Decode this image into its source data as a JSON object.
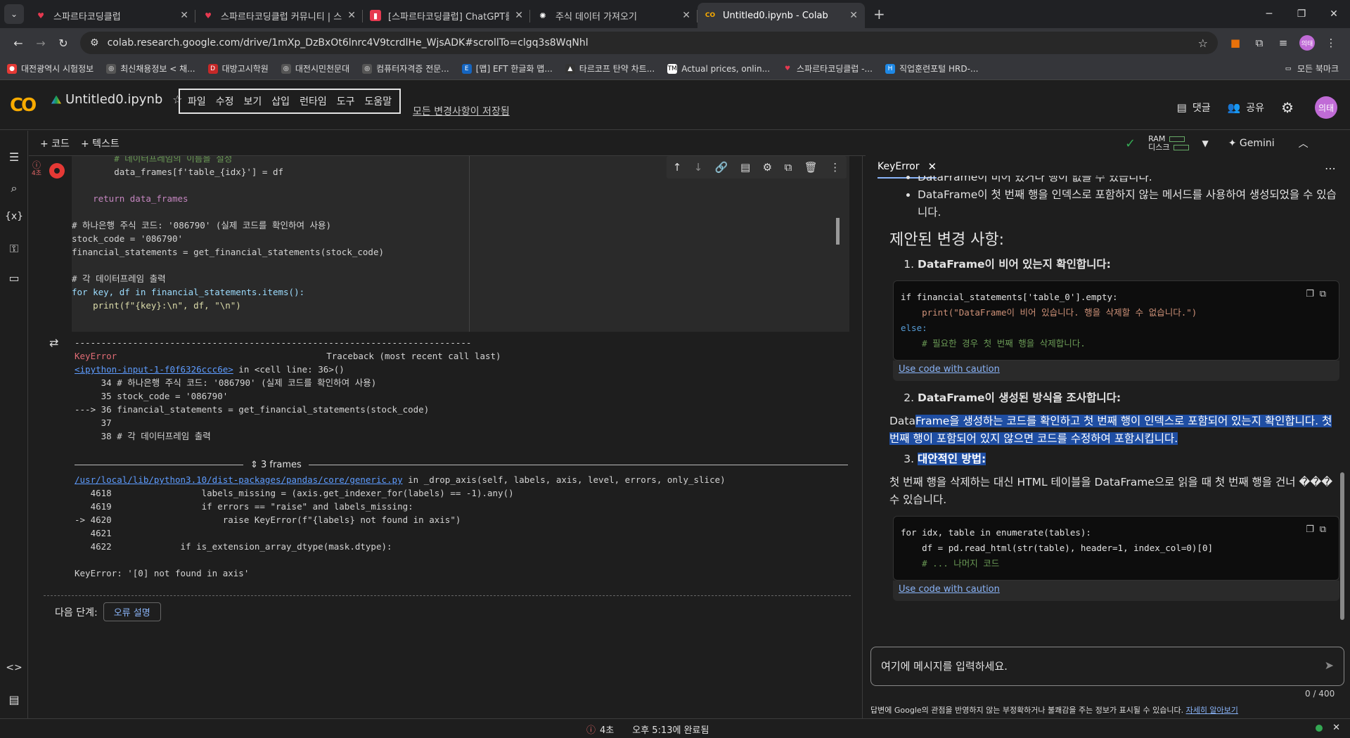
{
  "browser": {
    "tabs": [
      {
        "title": "스파르타코딩클럽",
        "icon": "heart-icon",
        "color": "#e63950"
      },
      {
        "title": "스파르타코딩클럽 커뮤니티 | 스",
        "icon": "heart-icon",
        "color": "#e63950"
      },
      {
        "title": "[스파르타코딩클럽] ChatGPT를",
        "icon": "bookmark-icon",
        "color": "#e63950"
      },
      {
        "title": "주식 데이터 가져오기",
        "icon": "openai-icon",
        "color": "#ffffff"
      },
      {
        "title": "Untitled0.ipynb - Colab",
        "icon": "colab-icon",
        "color": "#f9ab00",
        "active": true
      }
    ],
    "url": "colab.research.google.com/drive/1mXp_DzBxOt6lnrc4V9tcrdlHe_WjsADK#scrollTo=clgq3s8WqNhl",
    "bookmarks": [
      "대전광역시 시험정보",
      "최신채용정보 < 채...",
      "대방고시학원",
      "대전시민천문대",
      "컴퓨터자격증 전문...",
      "[맵] EFT 한글화 맵...",
      "타르코프 탄약 차트...",
      "Actual prices, onlin...",
      "스파르타코딩클럽 -...",
      "직업훈련포털 HRD-..."
    ],
    "bookmarks_all": "모든 북마크",
    "profile_initials": "의태"
  },
  "colab": {
    "logo": "CO",
    "title": "Untitled0.ipynb",
    "menus": [
      "파일",
      "수정",
      "보기",
      "삽입",
      "런타임",
      "도구",
      "도움말"
    ],
    "saved": "모든 변경사항이 저장됨",
    "comment": "댓글",
    "share": "공유",
    "avatar": "의태",
    "add_code": "+ 코드",
    "add_text": "+ 텍스트",
    "ram": "RAM",
    "disk": "디스크",
    "gemini": "Gemini",
    "exec_time": "4초"
  },
  "code_lines": [
    "        # 데이터프레임의 이름을 설정",
    "        data_frames[f'table_{idx}'] = df",
    "",
    "    return data_frames",
    "",
    "# 하나은행 주식 코드: '086790' (실제 코드를 확인하여 사용)",
    "stock_code = '086790'",
    "financial_statements = get_financial_statements(stock_code)",
    "",
    "# 각 데이터프레임 출력",
    "for key, df in financial_statements.items():",
    "    print(f\"{key}:\\n\", df, \"\\n\")"
  ],
  "traceback": {
    "divider": "---------------------------------------------------------------------------",
    "error_name": "KeyError",
    "tb_header": "Traceback (most recent call last)",
    "input_link": "<ipython-input-1-f0f6326ccc6e>",
    "input_loc": " in <cell line: 36>()",
    "l34": "     34 # 하나은행 주식 코드: '086790' (실제 코드를 확인하여 사용)",
    "l35": "     35 stock_code = '086790'",
    "l36": "---> 36 financial_statements = get_financial_statements(stock_code)",
    "l37": "     37",
    "l38": "     38 # 각 데이터프레임 출력",
    "frames": "3 frames",
    "file_link": "/usr/local/lib/python3.10/dist-packages/pandas/core/generic.py",
    "file_loc": " in _drop_axis(self, labels, axis, level, errors, only_slice)",
    "f4618": "   4618                 labels_missing = (axis.get_indexer_for(labels) == -1).any()",
    "f4619": "   4619                 if errors == \"raise\" and labels_missing:",
    "f4620": "-> 4620                     raise KeyError(f\"{labels} not found in axis\")",
    "f4621": "   4621",
    "f4622": "   4622             if is_extension_array_dtype(mask.dtype):",
    "final": "KeyError: '[0] not found in axis'"
  },
  "next_step": {
    "label": "다음 단계:",
    "button": "오류 설명"
  },
  "panel": {
    "tab": "KeyError",
    "bullet1": "DataFrame이 비어 있거나 행이 없을 수 있습니다.",
    "bullet2": "DataFrame이 첫 번째 행을 인덱스로 포함하지 않는 메서드를 사용하여 생성되었을 수 있습니다.",
    "heading": "제안된 변경 사항:",
    "step1": "DataFrame이 비어 있는지 확인합니다:",
    "code1": [
      "if financial_statements['table_0'].empty:",
      "    print(\"DataFrame이 비어 있습니다. 행을 삭제할 수 없습니다.\")",
      "else:",
      "    # 필요한 경우 첫 번째 행을 삭제합니다."
    ],
    "caution": "Use code with caution",
    "step2": "DataFrame이 생성된 방식을 조사합니다:",
    "para2a": "Data",
    "para2b": "Frame을 생성하는 코드를 확인하고 첫 번째 행이 인덱스로 포함되어 있는지 확인합니다. 첫 번째 행이 포함되어 있지 않으면 코드를 수정하여 포함시킵니다.",
    "step3": "대안적인 방법:",
    "para3": "첫 번째 행을 삭제하는 대신 HTML 테이블을 DataFrame으로 읽을 때 첫 번째 행을 건너 ��� 수 있습니다.",
    "code2": [
      "for idx, table in enumerate(tables):",
      "    df = pd.read_html(str(table), header=1, index_col=0)[0]",
      "    # ... 나머지 코드"
    ],
    "input_placeholder": "여기에 메시지를 입력하세요.",
    "counter": "0 / 400",
    "disclaimer": "답변에 Google의 관점을 반영하지 않는 부정확하거나 불쾌감을 주는 정보가 표시될 수 있습니다. ",
    "learn_more": "자세히 알아보기"
  },
  "status": {
    "errors": "4초",
    "time": "오후 5:13에 완료됨"
  }
}
